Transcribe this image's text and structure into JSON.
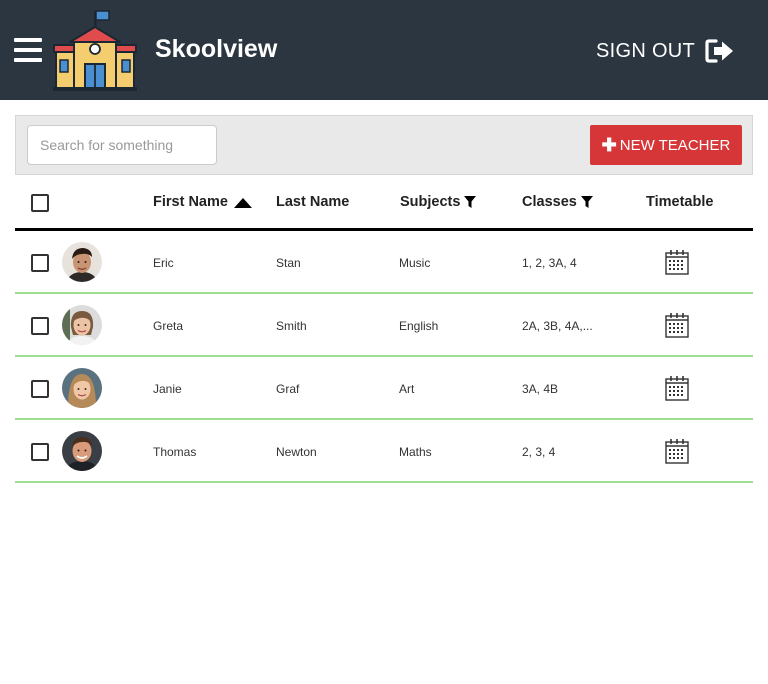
{
  "header": {
    "title": "Skoolview",
    "signout_label": "SIGN OUT",
    "bg_color": "#2c3640"
  },
  "toolbar": {
    "search_placeholder": "Search for something",
    "search_value": "",
    "new_button_label": "NEW TEACHER",
    "new_button_icon": "plus-icon",
    "accent_color": "#d63638"
  },
  "table": {
    "columns": {
      "first_name": "First Name",
      "last_name": "Last Name",
      "subjects": "Subjects",
      "classes": "Classes",
      "timetable": "Timetable"
    },
    "sort": {
      "column": "first_name",
      "direction": "ascending"
    },
    "row_divider_color": "#9ede93",
    "rows": [
      {
        "first_name": "Eric",
        "last_name": "Stan",
        "subjects": "Music",
        "classes": "1, 2, 3A, 4",
        "avatar": "avatar-eric"
      },
      {
        "first_name": "Greta",
        "last_name": "Smith",
        "subjects": "English",
        "classes": "2A, 3B, 4A,...",
        "avatar": "avatar-greta"
      },
      {
        "first_name": "Janie",
        "last_name": "Graf",
        "subjects": "Art",
        "classes": "3A, 4B",
        "avatar": "avatar-janie"
      },
      {
        "first_name": "Thomas",
        "last_name": "Newton",
        "subjects": "Maths",
        "classes": "2, 3, 4",
        "avatar": "avatar-thomas"
      }
    ]
  }
}
